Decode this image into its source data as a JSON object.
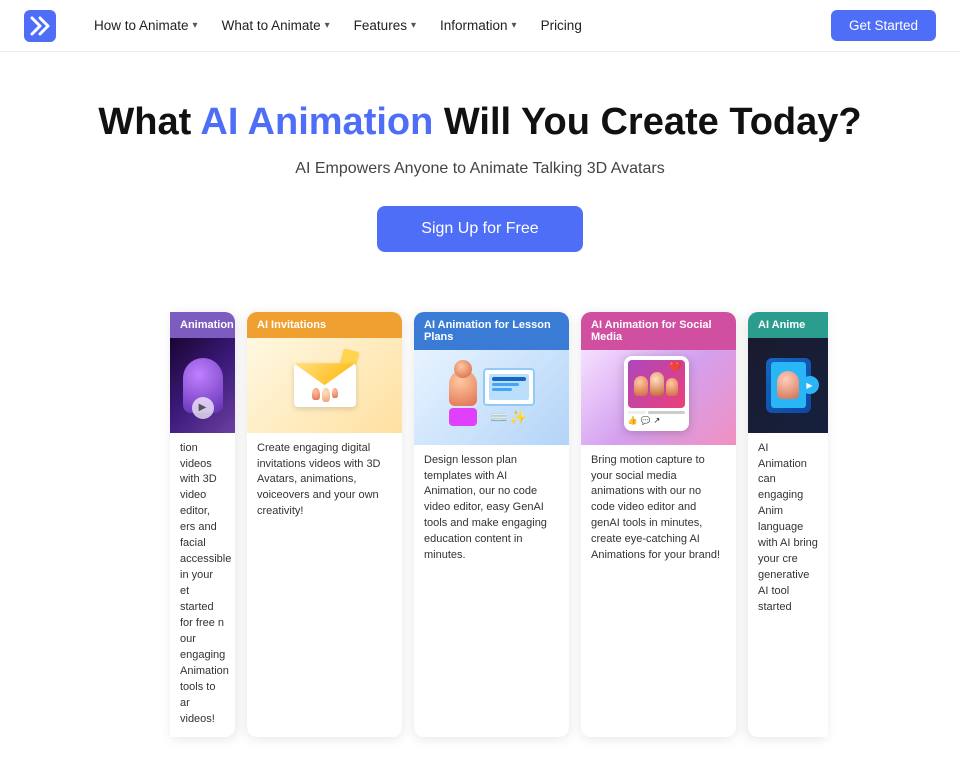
{
  "nav": {
    "logo_alt": "Krikey AI",
    "links": [
      {
        "label": "How to Animate",
        "has_dropdown": true
      },
      {
        "label": "What to Animate",
        "has_dropdown": true
      },
      {
        "label": "Features",
        "has_dropdown": true
      },
      {
        "label": "Information",
        "has_dropdown": true
      },
      {
        "label": "Pricing",
        "has_dropdown": false
      }
    ],
    "cta_label": "Get Started"
  },
  "hero": {
    "heading_prefix": "What ",
    "heading_highlight": "AI Animation",
    "heading_suffix": " Will You Create Today?",
    "subtitle": "AI Empowers Anyone to Animate Talking 3D Avatars",
    "cta_label": "Sign Up for Free"
  },
  "cards": {
    "partial_left": {
      "header_label": "Animation",
      "header_class": "purple",
      "text": "tion videos with 3D video editor, ers and facial accessible in your et started for free n our engaging Animation tools to ar videos!"
    },
    "items": [
      {
        "header_label": "AI Invitations",
        "header_class": "orange",
        "image_class": "img2",
        "text": "Create engaging digital invitations videos with 3D Avatars, animations, voiceovers and your own creativity!"
      },
      {
        "header_label": "AI Animation for Lesson Plans",
        "header_class": "blue",
        "image_class": "img3",
        "text": "Design lesson plan templates with AI Animation, our no code video editor, easy GenAI tools and make engaging education content in minutes."
      },
      {
        "header_label": "AI Animation for Social Media",
        "header_class": "pink",
        "image_class": "img4",
        "text": "Bring motion capture to your social media animations with our no code video editor and genAI tools in minutes, create eye-catching AI Animations for your brand!"
      }
    ],
    "partial_right": {
      "header_label": "AI Anime",
      "header_class": "teal",
      "text": "AI Animation can engaging Anim language with AI bring your cre generative AI tool started"
    }
  }
}
